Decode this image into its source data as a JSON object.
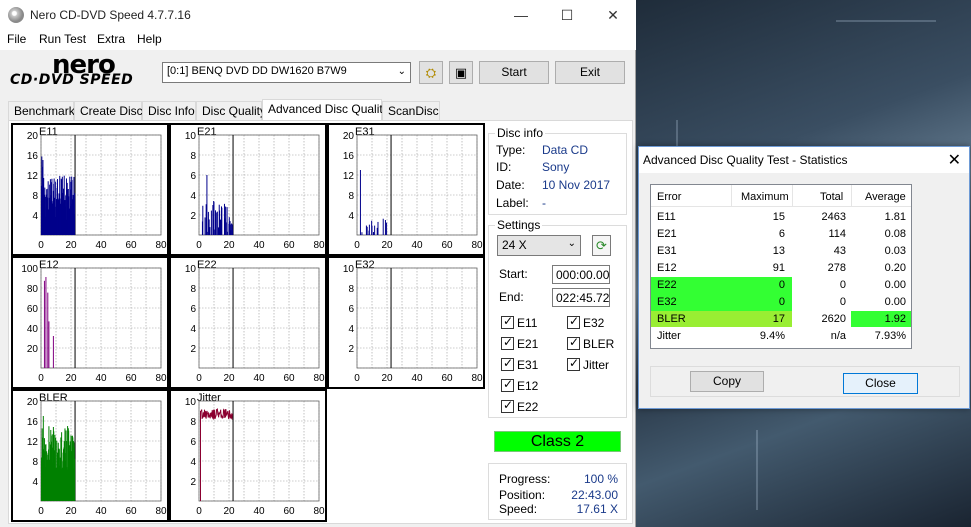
{
  "window": {
    "title": "Nero CD-DVD Speed 4.7.7.16",
    "minimize": "—",
    "maximize": "☐",
    "close": "✕"
  },
  "menu": [
    "File",
    "Run Test",
    "Extra",
    "Help"
  ],
  "logo": {
    "brand": "nero",
    "product": "CD·DVD SPEED"
  },
  "toolbar": {
    "drive": "[0:1]   BENQ DVD DD DW1620 B7W9",
    "start_label": "Start",
    "exit_label": "Exit"
  },
  "tabs": [
    "Benchmark",
    "Create Disc",
    "Disc Info",
    "Disc Quality",
    "Advanced Disc Quality",
    "ScanDisc"
  ],
  "active_tab": "Advanced Disc Quality",
  "graphs": [
    {
      "name": "E11",
      "ymax": 20,
      "yticks": [
        "20",
        "16",
        "12",
        "8",
        "4"
      ],
      "xticks": [
        "0",
        "20",
        "40",
        "60",
        "80"
      ],
      "color": "#00008b"
    },
    {
      "name": "E21",
      "ymax": 10,
      "yticks": [
        "10",
        "8",
        "6",
        "4",
        "2"
      ],
      "xticks": [
        "0",
        "20",
        "40",
        "60",
        "80"
      ],
      "color": "#00008b"
    },
    {
      "name": "E31",
      "ymax": 20,
      "yticks": [
        "20",
        "16",
        "12",
        "8",
        "4"
      ],
      "xticks": [
        "0",
        "20",
        "40",
        "60",
        "80"
      ],
      "color": "#00008b"
    },
    {
      "name": "E12",
      "ymax": 100,
      "yticks": [
        "100",
        "80",
        "60",
        "40",
        "20"
      ],
      "xticks": [
        "0",
        "20",
        "40",
        "60",
        "80"
      ],
      "color": "#800080"
    },
    {
      "name": "E22",
      "ymax": 10,
      "yticks": [
        "10",
        "8",
        "6",
        "4",
        "2"
      ],
      "xticks": [
        "0",
        "20",
        "40",
        "60",
        "80"
      ],
      "color": "#800080"
    },
    {
      "name": "E32",
      "ymax": 10,
      "yticks": [
        "10",
        "8",
        "6",
        "4",
        "2"
      ],
      "xticks": [
        "0",
        "20",
        "40",
        "60",
        "80"
      ],
      "color": "#800080"
    },
    {
      "name": "BLER",
      "ymax": 20,
      "yticks": [
        "20",
        "16",
        "12",
        "8",
        "4"
      ],
      "xticks": [
        "0",
        "20",
        "40",
        "60",
        "80"
      ],
      "color": "#008000"
    },
    {
      "name": "Jitter",
      "ymax": 10,
      "yticks": [
        "10",
        "8",
        "6",
        "4",
        "2"
      ],
      "xticks": [
        "0",
        "20",
        "40",
        "60",
        "80"
      ],
      "color": "#8b0030"
    }
  ],
  "disc_info": {
    "title": "Disc info",
    "type_label": "Type:",
    "type": "Data CD",
    "id_label": "ID:",
    "id": "Sony",
    "date_label": "Date:",
    "date": "10 Nov 2017",
    "label_label": "Label:",
    "label": "-"
  },
  "settings": {
    "title": "Settings",
    "speed": "24 X",
    "start_label": "Start:",
    "start": "000:00.00",
    "end_label": "End:",
    "end": "022:45.72",
    "checks": [
      "E11",
      "E32",
      "E21",
      "BLER",
      "E31",
      "Jitter",
      "E12",
      "E22"
    ]
  },
  "class_label": "Class 2",
  "progress": {
    "progress_label": "Progress:",
    "progress": "100 %",
    "position_label": "Position:",
    "position": "22:43.00",
    "speed_label": "Speed:",
    "speed": "17.61 X"
  },
  "stats": {
    "title": "Advanced Disc Quality Test - Statistics",
    "headers": [
      "Error",
      "Maximum",
      "Total",
      "Average"
    ],
    "rows": [
      [
        "E11",
        "15",
        "2463",
        "1.81"
      ],
      [
        "E21",
        "6",
        "114",
        "0.08"
      ],
      [
        "E31",
        "13",
        "43",
        "0.03"
      ],
      [
        "E12",
        "91",
        "278",
        "0.20"
      ],
      [
        "E22",
        "0",
        "0",
        "0.00"
      ],
      [
        "E32",
        "0",
        "0",
        "0.00"
      ],
      [
        "BLER",
        "17",
        "2620",
        "1.92"
      ],
      [
        "Jitter",
        "9.4%",
        "n/a",
        "7.93%"
      ]
    ],
    "copy_label": "Copy",
    "close_label": "Close",
    "highlight_color": "#33ff33"
  }
}
